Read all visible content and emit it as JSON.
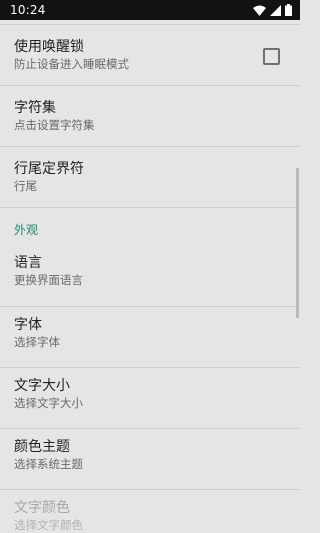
{
  "status_bar": {
    "time": "10:24",
    "icons": [
      "wifi-icon",
      "cellular-signal-icon",
      "battery-icon"
    ]
  },
  "settings": [
    {
      "title": "使用唤醒锁",
      "subtitle": "防止设备进入睡眠模式",
      "has_checkbox": true,
      "checked": false
    },
    {
      "title": "字符集",
      "subtitle": "点击设置字符集"
    },
    {
      "title": "行尾定界符",
      "subtitle": "行尾"
    }
  ],
  "section_appearance": {
    "header": "外观",
    "items": [
      {
        "title": "语言",
        "subtitle": "更换界面语言"
      },
      {
        "title": "字体",
        "subtitle": "选择字体"
      },
      {
        "title": "文字大小",
        "subtitle": "选择文字大小"
      },
      {
        "title": "颜色主题",
        "subtitle": "选择系统主题"
      },
      {
        "title": "文字颜色",
        "subtitle": "选择文字颜色",
        "disabled": true
      }
    ]
  },
  "colors": {
    "accent": "#1b8a74",
    "background": "#e5e5e5",
    "status_bar": "#121212"
  }
}
